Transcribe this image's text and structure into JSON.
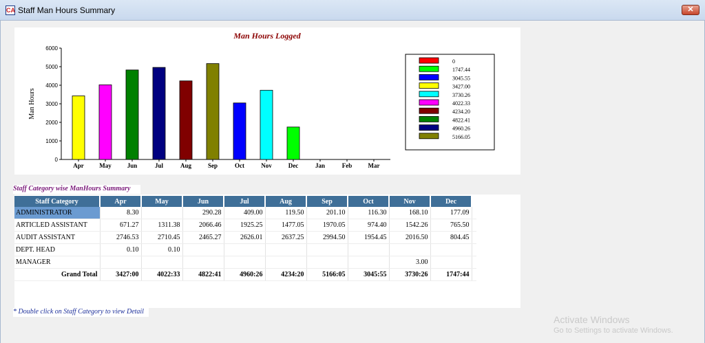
{
  "window": {
    "title": "Staff Man Hours Summary",
    "close_label": "✕"
  },
  "chart_data": {
    "type": "bar",
    "title": "Man Hours Logged",
    "ylabel": "Man Hours",
    "xlabel": "",
    "ylim": [
      0,
      6000
    ],
    "yticks": [
      0,
      1000,
      2000,
      3000,
      4000,
      5000,
      6000
    ],
    "categories": [
      "Apr",
      "May",
      "Jun",
      "Jul",
      "Aug",
      "Sep",
      "Oct",
      "Nov",
      "Dec",
      "Jan",
      "Feb",
      "Mar"
    ],
    "values": [
      3427.0,
      4022.33,
      4822.41,
      4960.26,
      4234.2,
      5166.05,
      3045.55,
      3730.26,
      1747.44,
      0,
      0,
      0
    ],
    "colors": [
      "#ffff00",
      "#ff00ff",
      "#008000",
      "#000080",
      "#800000",
      "#808000",
      "#0000ff",
      "#00ffff",
      "#00ff00",
      "#ff0000",
      "#ff0000",
      "#ff0000"
    ],
    "legend": {
      "placement": "right",
      "entries": [
        {
          "label": "0",
          "color": "#ff0000"
        },
        {
          "label": "1747.44",
          "color": "#00ff00"
        },
        {
          "label": "3045.55",
          "color": "#0000ff"
        },
        {
          "label": "3427.00",
          "color": "#ffff00"
        },
        {
          "label": "3730.26",
          "color": "#00ffff"
        },
        {
          "label": "4022.33",
          "color": "#ff00ff"
        },
        {
          "label": "4234.20",
          "color": "#800000"
        },
        {
          "label": "4822.41",
          "color": "#008000"
        },
        {
          "label": "4960.26",
          "color": "#000080"
        },
        {
          "label": "5166.05",
          "color": "#808000"
        }
      ]
    }
  },
  "summary": {
    "title": "Staff Category wise ManHours Summary",
    "columns": [
      "Staff Category",
      "Apr",
      "May",
      "Jun",
      "Jul",
      "Aug",
      "Sep",
      "Oct",
      "Nov",
      "Dec"
    ],
    "rows": [
      {
        "category": "ADMINISTRATOR",
        "values": [
          "8.30",
          "",
          "290.28",
          "409.00",
          "119.50",
          "201.10",
          "116.30",
          "168.10",
          "177.09"
        ],
        "selected": true
      },
      {
        "category": "ARTICLED ASSISTANT",
        "values": [
          "671.27",
          "1311.38",
          "2066.46",
          "1925.25",
          "1477.05",
          "1970.05",
          "974.40",
          "1542.26",
          "765.50"
        ]
      },
      {
        "category": "AUDIT ASSISTANT",
        "values": [
          "2746.53",
          "2710.45",
          "2465.27",
          "2626.01",
          "2637.25",
          "2994.50",
          "1954.45",
          "2016.50",
          "804.45"
        ]
      },
      {
        "category": "DEPT. HEAD",
        "values": [
          "0.10",
          "0.10",
          "",
          "",
          "",
          "",
          "",
          "",
          ""
        ]
      },
      {
        "category": "MANAGER",
        "values": [
          "",
          "",
          "",
          "",
          "",
          "",
          "",
          "3.00",
          ""
        ]
      }
    ],
    "total": {
      "label": "Grand Total",
      "values": [
        "3427:00",
        "4022:33",
        "4822:41",
        "4960:26",
        "4234:20",
        "5166:05",
        "3045:55",
        "3730:26",
        "1747:44"
      ]
    },
    "hint": "* Double click on Staff Category to view Detail"
  },
  "os": {
    "activate_title": "Activate Windows",
    "activate_sub": "Go to Settings to activate Windows."
  }
}
